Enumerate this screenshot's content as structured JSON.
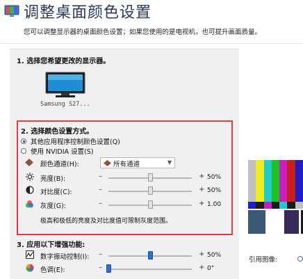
{
  "header": {
    "title": "调整桌面颜色设置",
    "description": "您可以调整显示器的桌面颜色设置；如果您使用的是电视机，也可提升画面质量。"
  },
  "section1": {
    "title": "1. 选择您希望更改的显示器。",
    "display_name": "Samsung S27..."
  },
  "section2": {
    "title": "2. 选择颜色设置方式。",
    "radio_other": "其他应用程序控制颜色设置(Q)",
    "radio_nvidia": "使用 NVIDIA 设置(S)",
    "selected_option": "other",
    "color_channel_label": "颜色通道(H):",
    "color_channel_value": "所有通道",
    "sliders": [
      {
        "label": "亮度(B):",
        "minus": "–",
        "plus": "+",
        "value": "50%",
        "position": 0.5
      },
      {
        "label": "对比度(C):",
        "minus": "–",
        "plus": "+",
        "value": "50%",
        "position": 0.5
      },
      {
        "label": "灰度(G):",
        "minus": "–",
        "plus": "+",
        "value": "1.00",
        "position": 0.5
      }
    ],
    "note": "极高和极低的亮度及对比度值可限制灰度范围。"
  },
  "section3": {
    "title": "3. 应用以下增强功能:",
    "sliders": [
      {
        "label": "数字振动控制(I):",
        "minus": "–",
        "plus": "+",
        "value": "50%",
        "position": 0.5
      },
      {
        "label": "色调(E):",
        "minus": "–",
        "plus": "+",
        "value": "0°",
        "position": 0.0
      }
    ]
  },
  "reference": {
    "label": "引用图像:",
    "bar_colors": [
      "#c0c0c0",
      "#ecec1e",
      "#1ecaca",
      "#20c020",
      "#c81ec8",
      "#c81e1e",
      "#1e1ec8"
    ],
    "strip_colors": [
      "#1e1ec8",
      "#1a1a1a",
      "#c81ec8",
      "#1a1a1a",
      "#1ecaca",
      "#1a1a1a",
      "#c0c0c0"
    ],
    "block_colors": [
      "#3a5a78",
      "#ffffff",
      "#3a2a5a",
      "#1a1a1a"
    ]
  },
  "colors": {
    "highlight_border": "#d9413c",
    "slider_thumb_active": "#2f6fc8"
  }
}
